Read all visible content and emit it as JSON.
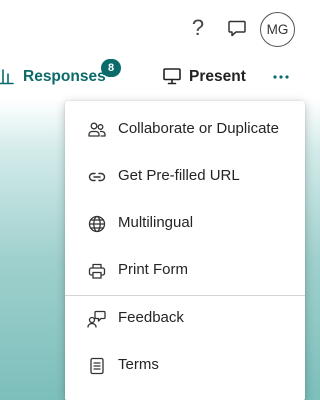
{
  "header": {
    "help_icon": "question-mark-icon",
    "help_glyph": "?",
    "comment_icon": "comment-icon",
    "avatar_initials": "MG"
  },
  "toolbar": {
    "responses_label": "Responses",
    "responses_icon": "bar-chart-icon",
    "responses_count": "8",
    "present_label": "Present",
    "present_icon": "presentation-icon",
    "more_icon": "more-horizontal-icon"
  },
  "menu": {
    "items": [
      {
        "label": "Collaborate or Duplicate",
        "icon": "people-icon"
      },
      {
        "label": "Get Pre-filled URL",
        "icon": "link-icon"
      },
      {
        "label": "Multilingual",
        "icon": "globe-icon"
      },
      {
        "label": "Print Form",
        "icon": "printer-icon"
      },
      {
        "label": "Feedback",
        "icon": "feedback-icon"
      },
      {
        "label": "Terms",
        "icon": "document-icon"
      }
    ]
  },
  "colors": {
    "accent": "#0b6a6a",
    "background_gradient_end": "#7cbfbb"
  }
}
